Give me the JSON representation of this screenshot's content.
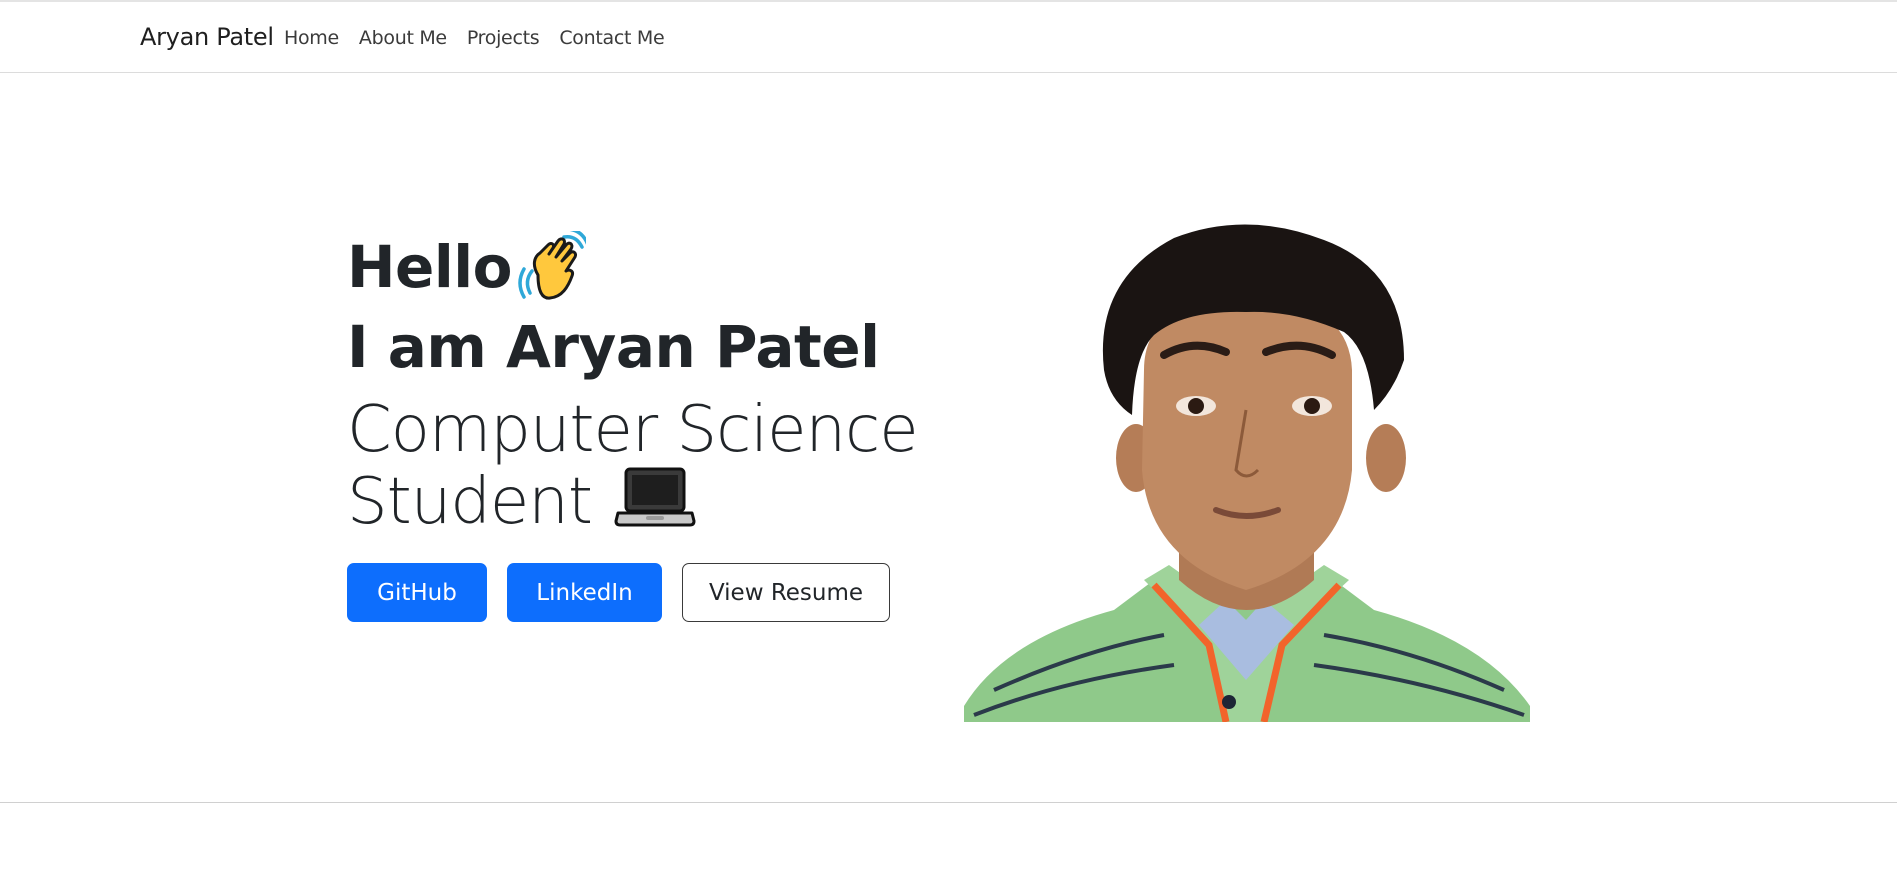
{
  "navbar": {
    "brand": "Aryan Patel",
    "links": [
      "Home",
      "About Me",
      "Projects",
      "Contact Me"
    ]
  },
  "hero": {
    "greeting": "Hello",
    "greeting_emoji": "waving-hand-icon",
    "name_line": "I am Aryan Patel",
    "role_line1": "Computer Science",
    "role_line2": "Student",
    "role_emoji": "laptop-icon",
    "buttons": {
      "github": "GitHub",
      "linkedin": "LinkedIn",
      "resume": "View Resume"
    }
  },
  "colors": {
    "primary": "#0d6efd",
    "text": "#212529",
    "shirt": "#8fc98a"
  }
}
